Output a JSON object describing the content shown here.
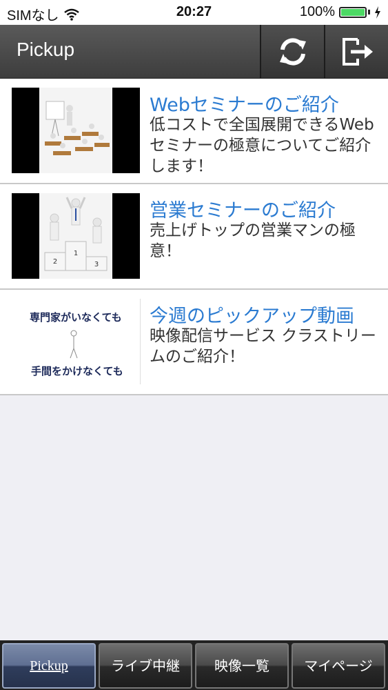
{
  "status_bar": {
    "carrier": "SIMなし",
    "time": "20:27",
    "battery_percent": "100%",
    "battery_level": 1.0
  },
  "header": {
    "title": "Pickup",
    "refresh_icon": "refresh-icon",
    "logout_icon": "logout-icon"
  },
  "items": [
    {
      "title": "Webセミナーのご紹介",
      "description": "低コストで全国展開できるWebセミナーの極意についてご紹介します！"
    },
    {
      "title": "営業セミナーのご紹介",
      "description": "売上げトップの営業マンの極意！"
    },
    {
      "title": "今週のピックアップ動画",
      "description": "映像配信サービス クラストリームのご紹介！",
      "thumb_text_top": "専門家がいなくても",
      "thumb_text_bottom": "手間をかけなくても"
    }
  ],
  "tabs": [
    {
      "label": "Pickup",
      "active": true
    },
    {
      "label": "ライブ中継",
      "active": false
    },
    {
      "label": "映像一覧",
      "active": false
    },
    {
      "label": "マイページ",
      "active": false
    }
  ],
  "colors": {
    "link_blue": "#2b7bd1",
    "battery_green": "#4cd964",
    "header_bg": "#4a4a4a"
  }
}
